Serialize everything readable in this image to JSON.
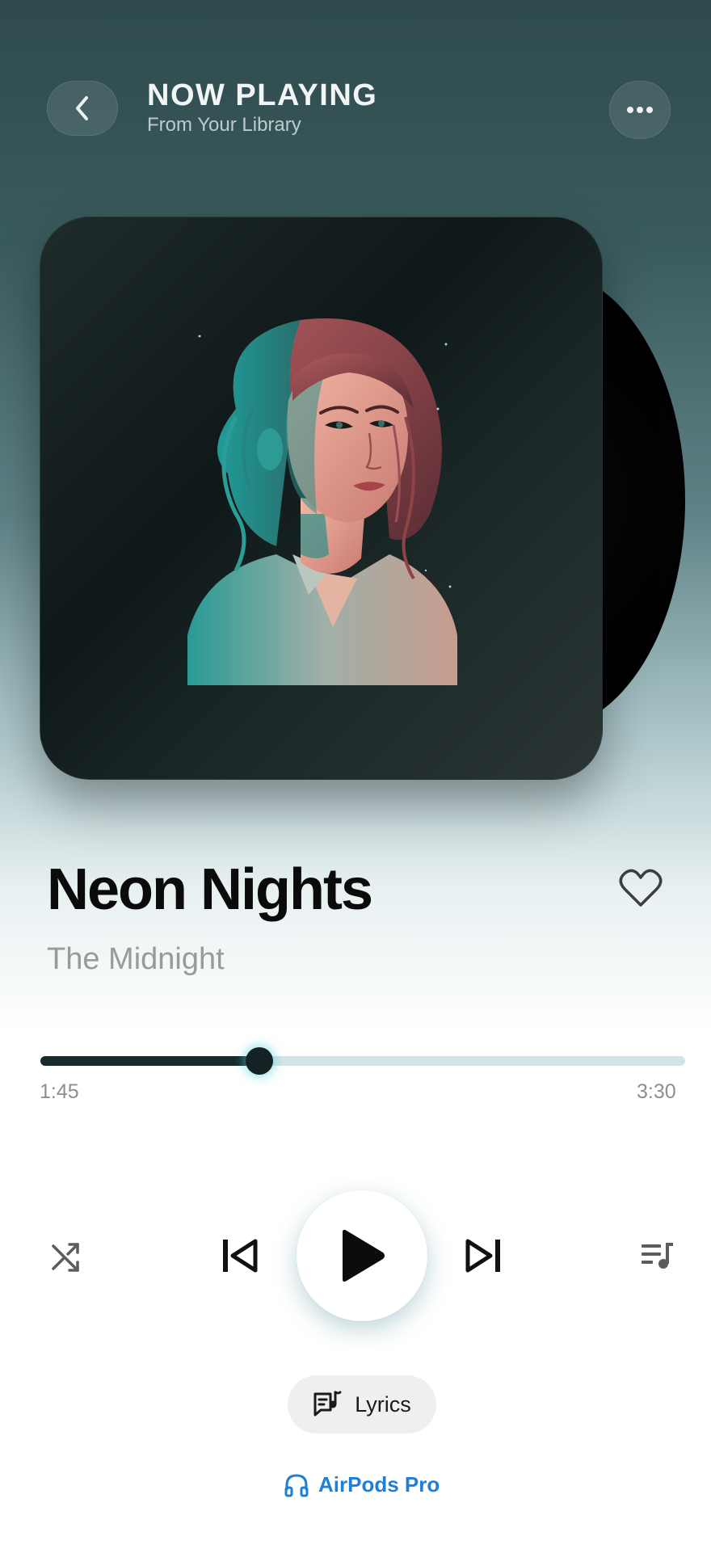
{
  "header": {
    "title": "NOW PLAYING",
    "subtitle": "From Your Library"
  },
  "track": {
    "title": "Neon Nights",
    "artist": "The Midnight",
    "liked": false
  },
  "progress": {
    "elapsed": "1:45",
    "total": "3:30",
    "fraction": 0.34
  },
  "controls": {
    "lyrics_label": "Lyrics",
    "device_label": "AirPods Pro"
  },
  "icons": {
    "back": "chevron-left-icon",
    "more": "more-horizontal-icon",
    "heart": "heart-icon",
    "shuffle": "shuffle-icon",
    "previous": "skip-previous-icon",
    "play": "play-icon",
    "next": "skip-next-icon",
    "queue": "queue-music-icon",
    "lyrics": "lyrics-icon",
    "device": "headphones-icon"
  },
  "colors": {
    "accent": "#1e7fd6",
    "progress_fill": "#182a2b",
    "progress_track": "#d4e4e6",
    "knob_glow": "#48d2dc"
  }
}
